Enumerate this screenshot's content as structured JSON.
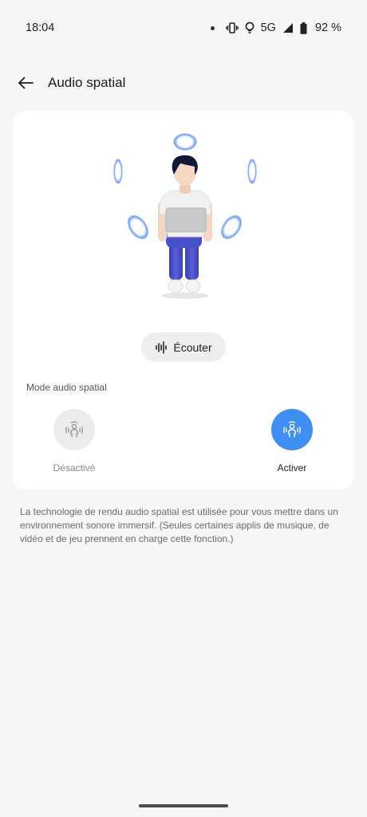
{
  "status_bar": {
    "time": "18:04",
    "network": "5G",
    "battery": "92 %"
  },
  "header": {
    "title": "Audio spatial",
    "back_icon": "arrow-left-icon"
  },
  "card": {
    "listen_button": {
      "label": "Écouter",
      "icon": "waveform-icon"
    },
    "mode_label": "Mode audio spatial",
    "modes": [
      {
        "label": "Désactivé",
        "icon": "spatial-audio-person-icon",
        "selected": false
      },
      {
        "label": "Activer",
        "icon": "spatial-audio-person-icon",
        "selected": true
      }
    ]
  },
  "description": "La technologie de rendu audio spatial est utilisée pour vous mettre dans un environnement sonore immersif. (Seules certaines applis de musique, de vidéo et de jeu prennent en charge cette fonction.)",
  "colors": {
    "accent": "#3f8ef2",
    "background": "#f6f6f6",
    "card": "#ffffff"
  }
}
